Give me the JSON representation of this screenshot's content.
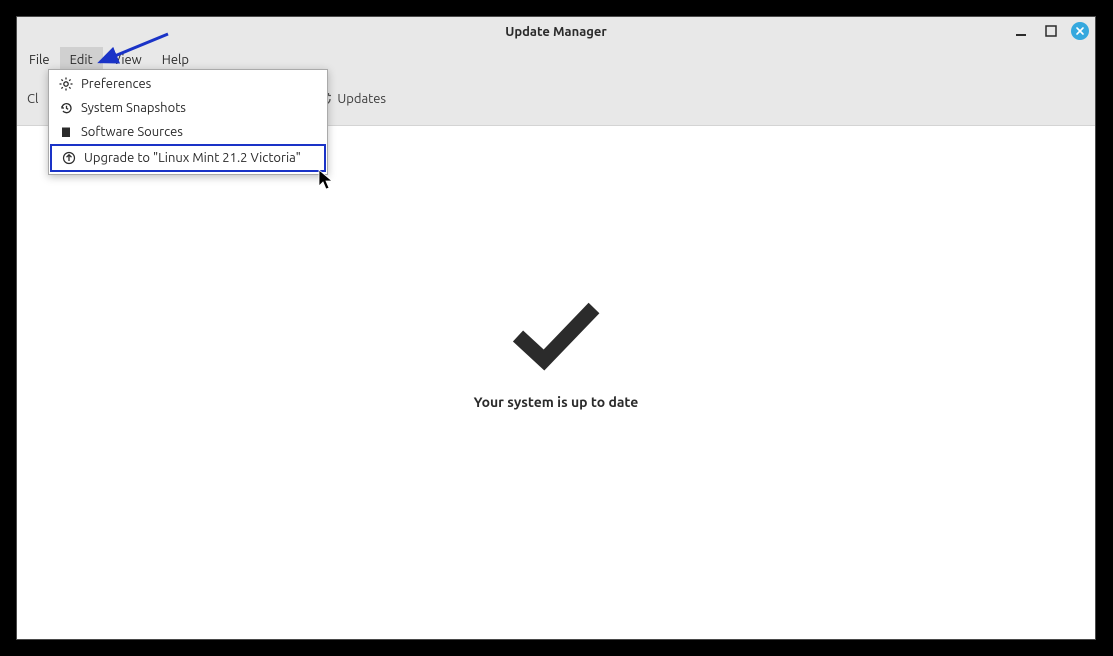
{
  "window": {
    "title": "Update Manager"
  },
  "menubar": {
    "file": "File",
    "edit": "Edit",
    "view": "View",
    "help": "Help"
  },
  "toolbar": {
    "clear_label_prefix": "Cl",
    "updates_label": "Updates"
  },
  "dropdown": {
    "preferences": "Preferences",
    "system_snapshots": "System Snapshots",
    "software_sources": "Software Sources",
    "upgrade": "Upgrade to \"Linux Mint 21.2 Victoria\""
  },
  "main": {
    "status_text": "Your system is up to date"
  }
}
